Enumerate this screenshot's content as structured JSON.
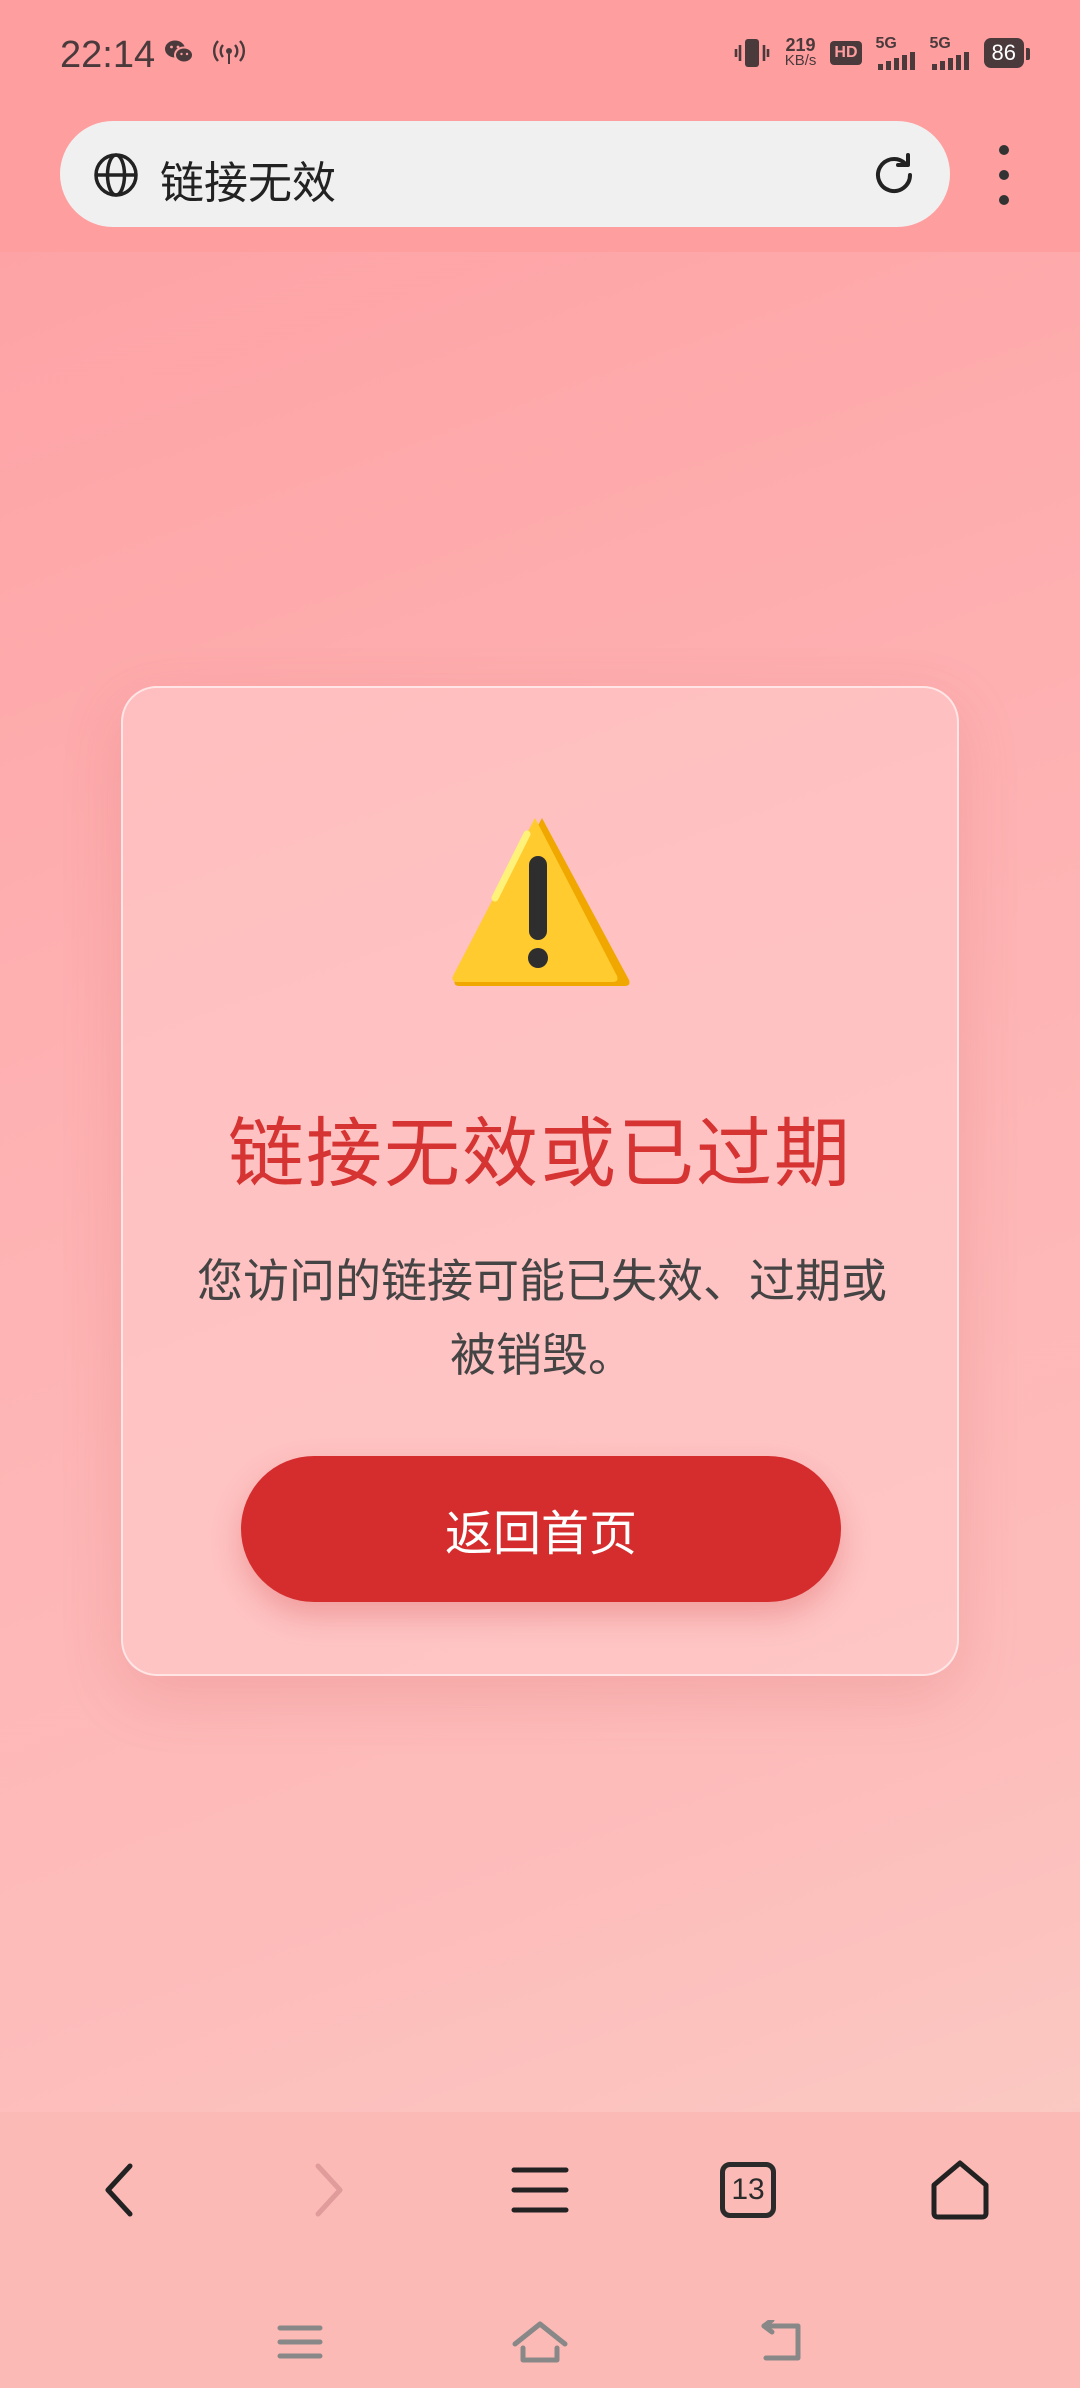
{
  "status_bar": {
    "time": "22:14",
    "net_speed_value": "219",
    "net_speed_unit": "KB/s",
    "hd_label": "HD",
    "sim1_label": "5G",
    "sim2_label": "5G",
    "battery": "86"
  },
  "browser": {
    "address_text": "链接无效"
  },
  "error_card": {
    "title": "链接无效或已过期",
    "description": "您访问的链接可能已失效、过期或被销毁。",
    "button_label": "返回首页",
    "accent_color": "#d52d2e"
  },
  "toolbar": {
    "tabs_count": "13"
  }
}
